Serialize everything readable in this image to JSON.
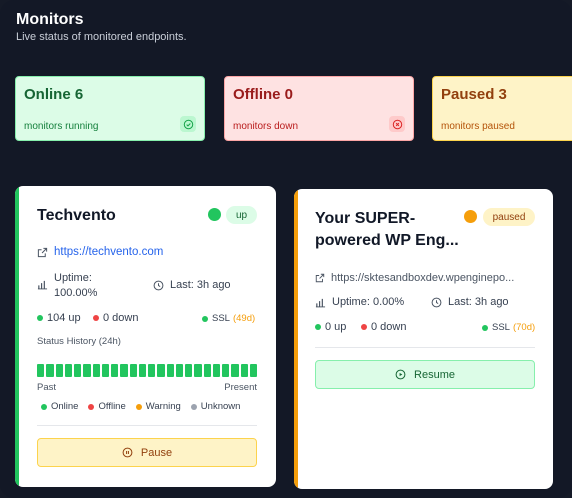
{
  "header": {
    "title": "Monitors",
    "subtitle": "Live status of monitored endpoints."
  },
  "stats": {
    "online": {
      "title": "Online 6",
      "sub": "monitors running"
    },
    "offline": {
      "title": "Offline 0",
      "sub": "monitors down"
    },
    "paused": {
      "title": "Paused 3",
      "sub": "monitors paused"
    }
  },
  "colors": {
    "up": "#22c55e",
    "paused": "#f59e0b",
    "down": "#ef4444",
    "unknown": "#9ca3af"
  },
  "monitors": [
    {
      "name": "Techvento",
      "status": "up",
      "url": "https://techvento.com",
      "uptime_label": "Uptime:",
      "uptime_value": "100.00%",
      "last": "Last: 3h ago",
      "up_count": "104 up",
      "down_count": "0 down",
      "ssl": "SSL",
      "ssl_days": "(49d)",
      "history_label": "Status History (24h)",
      "history_bars": 24,
      "past": "Past",
      "present": "Present",
      "legend": [
        "Online",
        "Offline",
        "Warning",
        "Unknown"
      ],
      "action": "Pause"
    },
    {
      "name_line1": "Your SUPER-",
      "name_line2": "powered WP Eng...",
      "status": "paused",
      "url": "https://sktesandboxdev.wpenginepo...",
      "uptime": "Uptime: 0.00%",
      "last": "Last: 3h ago",
      "up_count": "0 up",
      "down_count": "0 down",
      "ssl": "SSL",
      "ssl_days": "(70d)",
      "action": "Resume"
    }
  ]
}
